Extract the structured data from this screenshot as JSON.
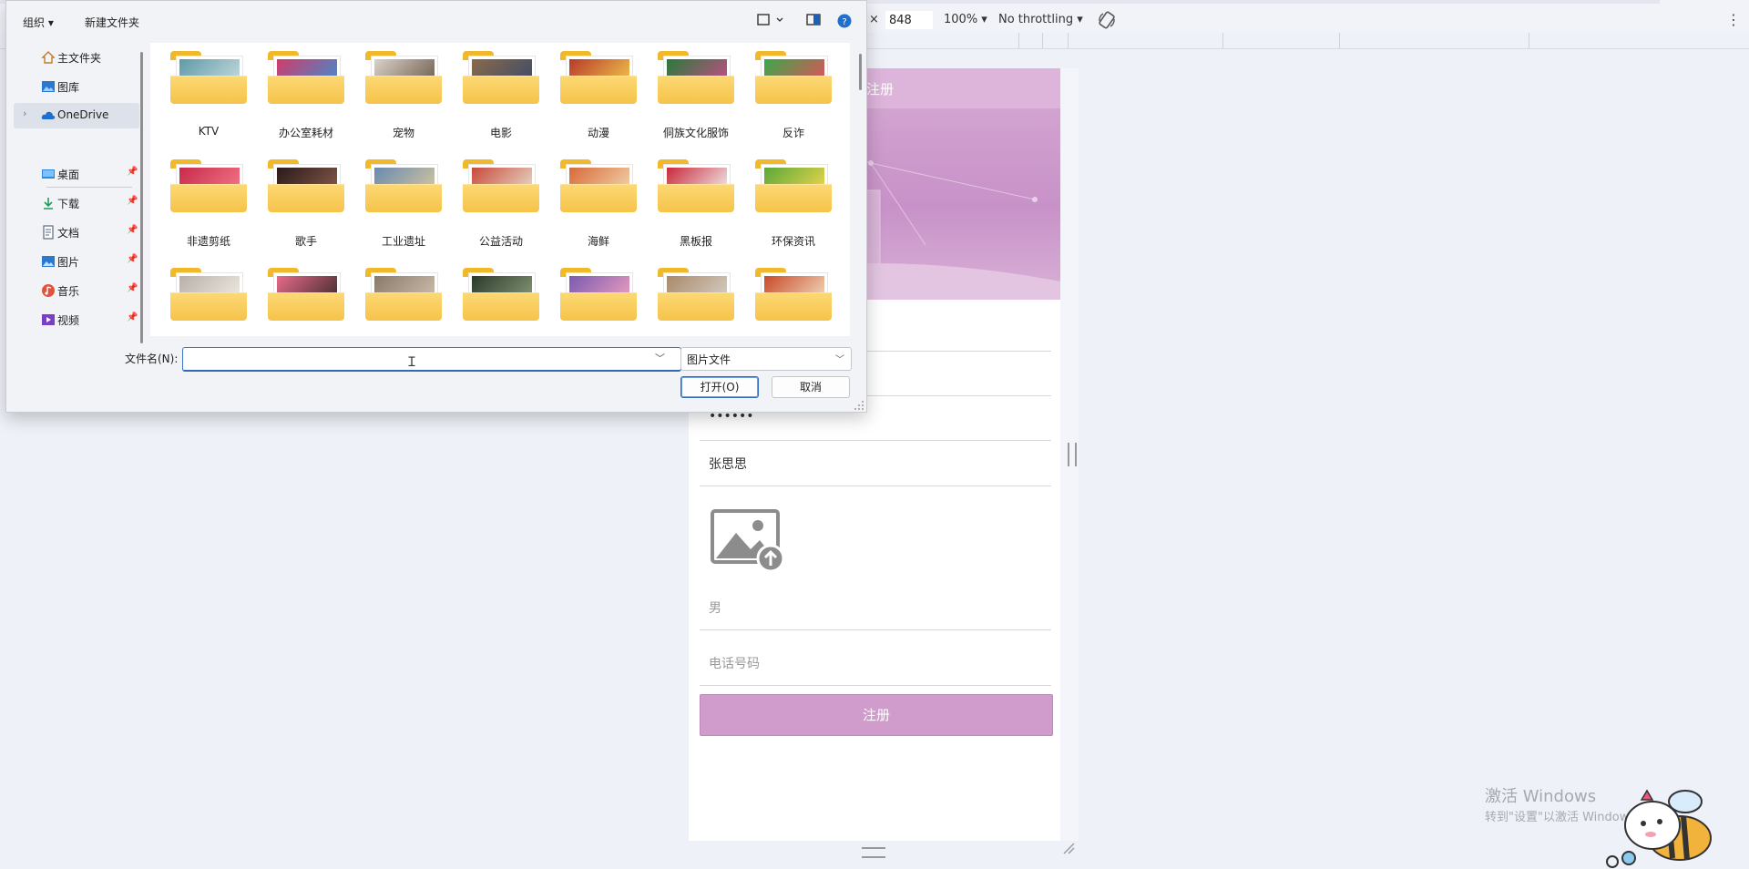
{
  "devtools": {
    "dim_separator": "×",
    "height": "848",
    "zoom": "100%",
    "throttle": "No throttling",
    "more_icon": "⋮"
  },
  "dialog": {
    "toolbar": {
      "organize": "组织",
      "new_folder": "新建文件夹"
    },
    "nav": [
      {
        "label": "主文件夹",
        "icon": "home-icon"
      },
      {
        "label": "图库",
        "icon": "gallery-icon"
      },
      {
        "label": "OneDrive",
        "icon": "cloud-icon"
      },
      {
        "label": "桌面",
        "icon": "desktop-icon"
      },
      {
        "label": "下载",
        "icon": "download-icon"
      },
      {
        "label": "文档",
        "icon": "document-icon"
      },
      {
        "label": "图片",
        "icon": "pictures-icon"
      },
      {
        "label": "音乐",
        "icon": "music-icon"
      },
      {
        "label": "视频",
        "icon": "video-icon"
      }
    ],
    "folders": [
      "KTV",
      "办公室耗材",
      "宠物",
      "电影",
      "动漫",
      "侗族文化服饰",
      "反诈",
      "非遗剪纸",
      "歌手",
      "工业遗址",
      "公益活动",
      "海鲜",
      "黑板报",
      "环保资讯",
      "",
      "",
      "",
      "",
      "",
      "",
      ""
    ],
    "filename_label": "文件名(N):",
    "filename_value": "",
    "file_type": "图片文件",
    "open_label": "打开(O)",
    "cancel_label": "取消"
  },
  "form": {
    "header_title": "注册",
    "password_masked": "••••••",
    "name_value": "张思思",
    "gender_placeholder": "男",
    "phone_placeholder": "电话号码",
    "submit_label": "注册"
  },
  "watermark": {
    "line1": "激活 Windows",
    "line2": "转到\"设置\"以激活 Windows。"
  },
  "colors": {
    "accent_pink": "#cf9ccb",
    "banner_pink": "#c892c8",
    "folder_yellow": "#f6c34a",
    "selection_blue": "#2f6ab8"
  }
}
